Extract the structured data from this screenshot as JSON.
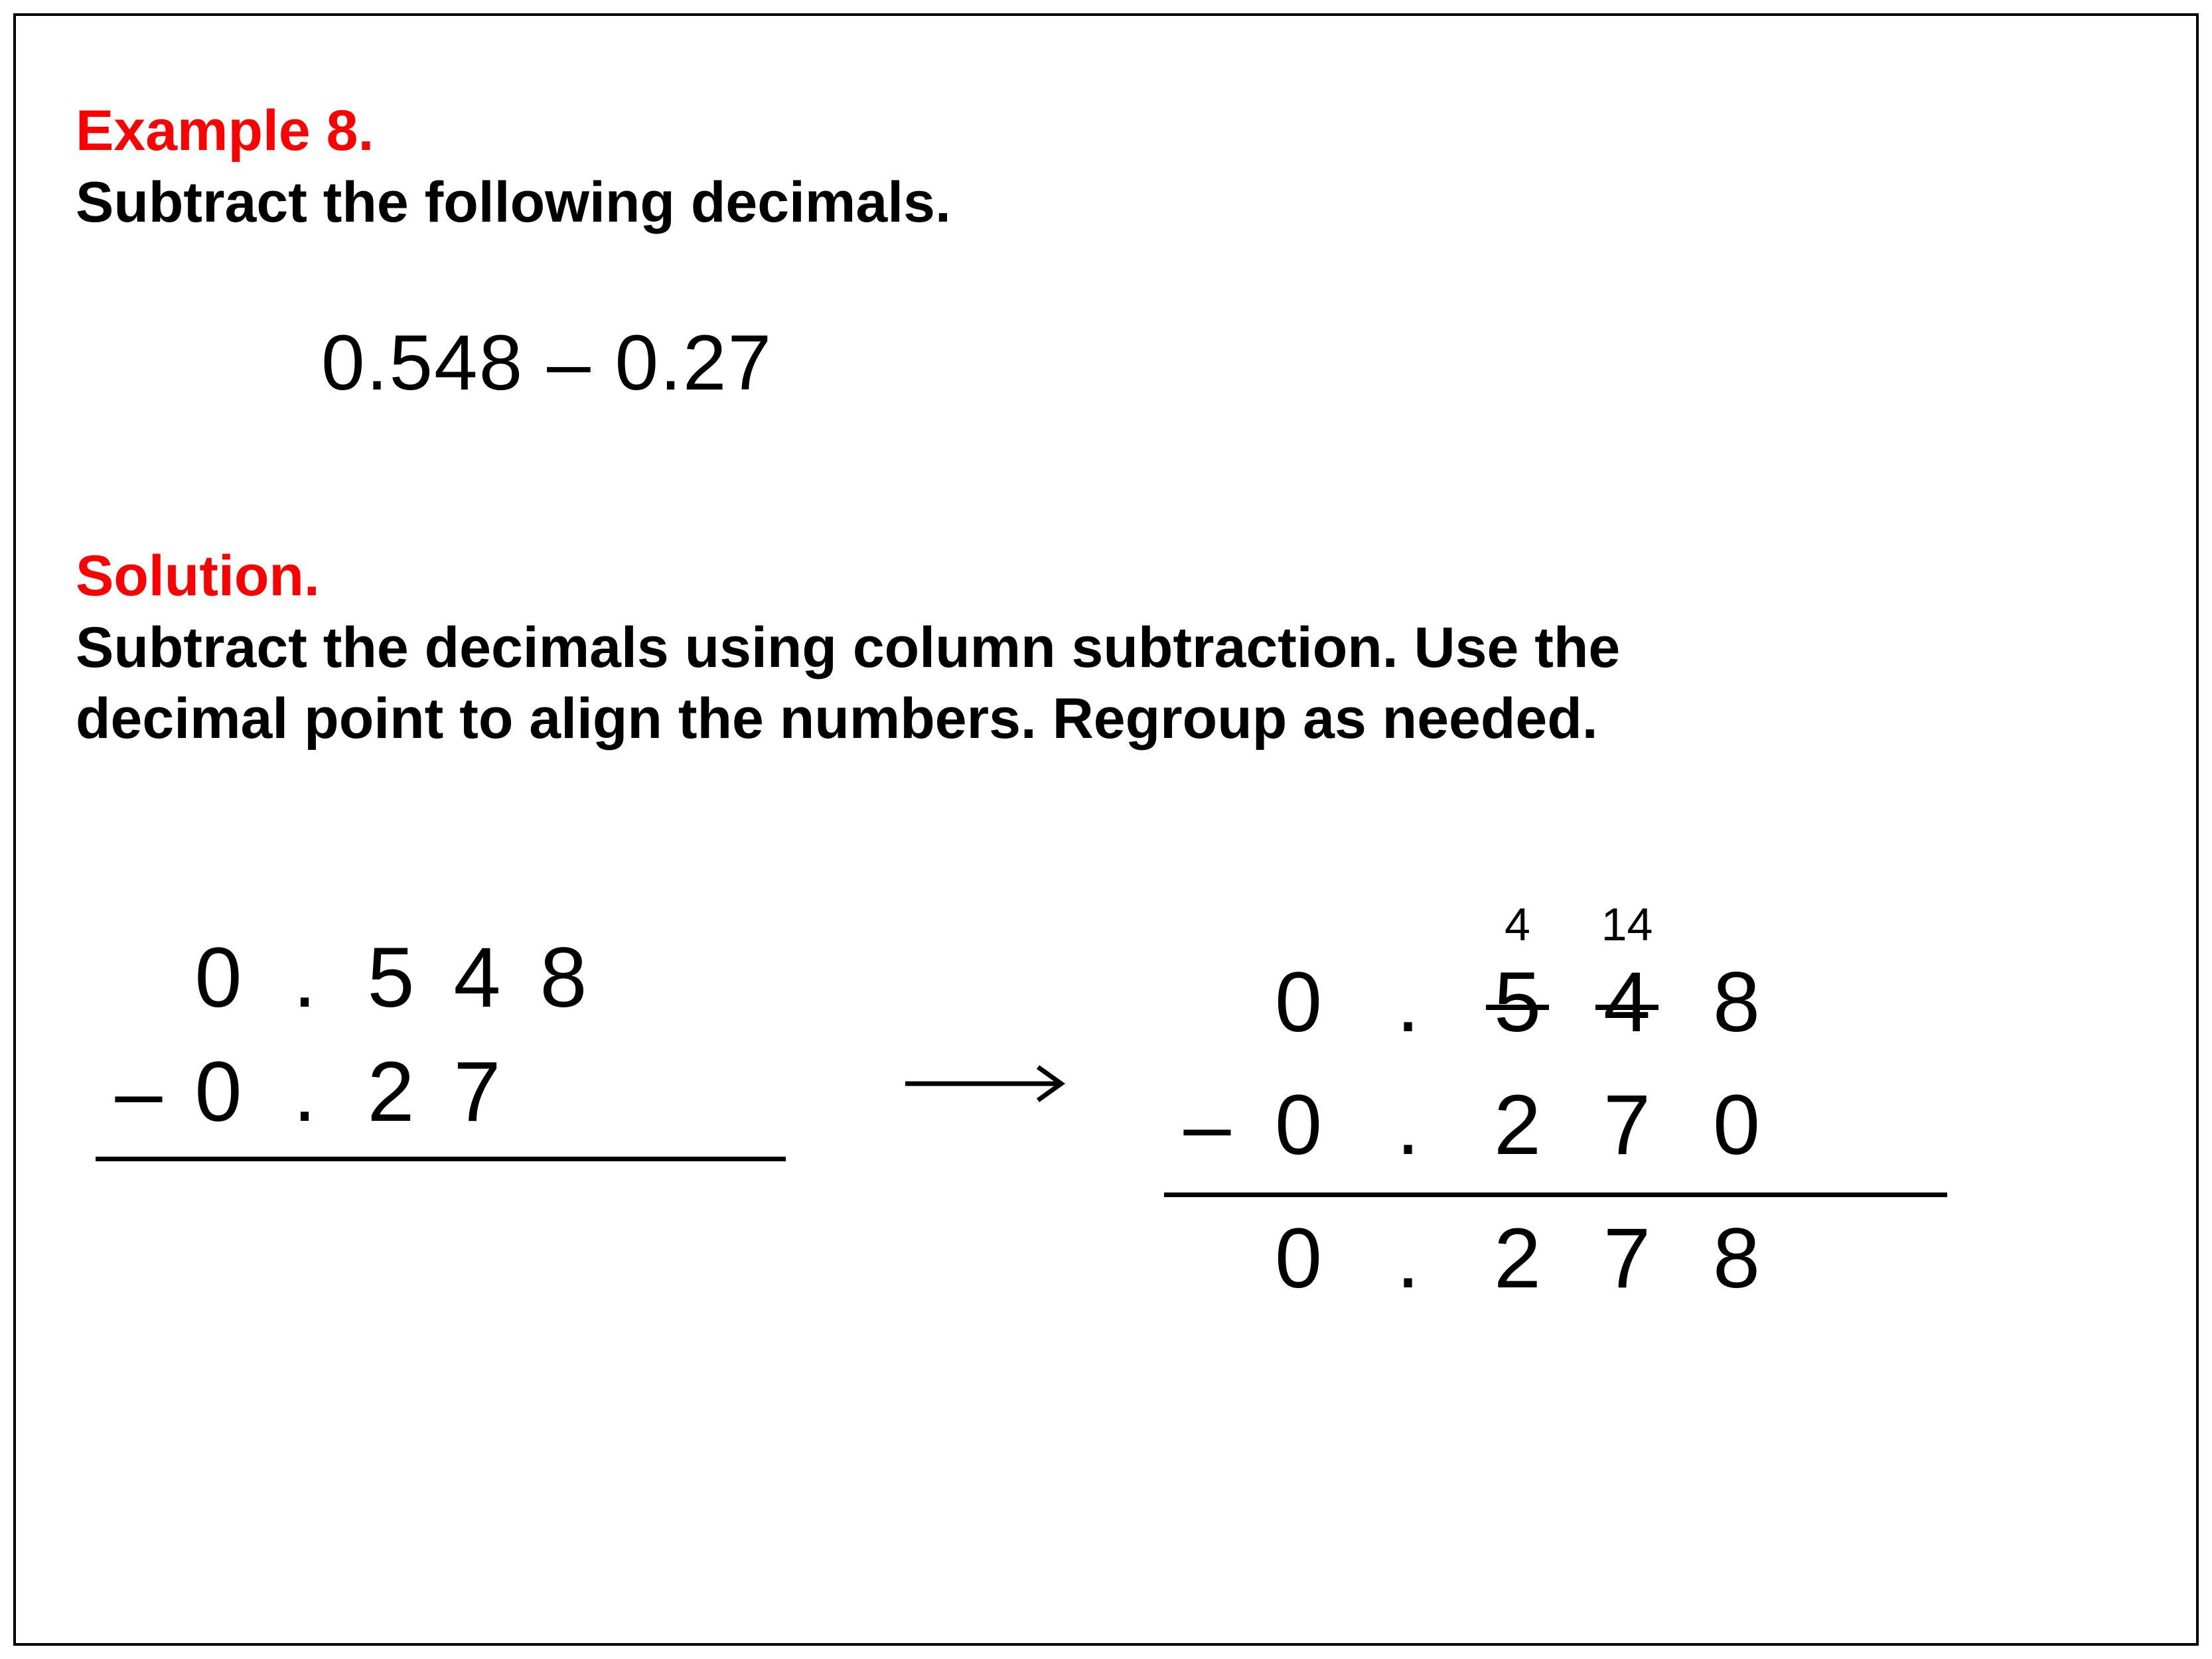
{
  "header": {
    "example_label": "Example 8.",
    "instruction": "Subtract the following decimals."
  },
  "problem": {
    "expression": "0.548 – 0.27"
  },
  "solution": {
    "label": "Solution.",
    "text": "Subtract the decimals using column subtraction. Use the decimal point to align the numbers. Regroup as needed."
  },
  "work_left": {
    "top": {
      "d0": "0",
      "dot": ".",
      "d1": "5",
      "d2": "4",
      "d3": "8"
    },
    "bottom": {
      "minus": "–",
      "d0": "0",
      "dot": ".",
      "d1": "2",
      "d2": "7",
      "d3": ""
    }
  },
  "work_right": {
    "carry": {
      "c0": "",
      "cdot": "",
      "c1": "4",
      "c2": "14",
      "c3": ""
    },
    "top": {
      "d0": "0",
      "dot": ".",
      "d1": "5",
      "d2": "4",
      "d3": "8"
    },
    "bottom": {
      "minus": "–",
      "d0": "0",
      "dot": ".",
      "d1": "2",
      "d2": "7",
      "d3": "0"
    },
    "result": {
      "d0": "0",
      "dot": ".",
      "d1": "2",
      "d2": "7",
      "d3": "8"
    }
  }
}
